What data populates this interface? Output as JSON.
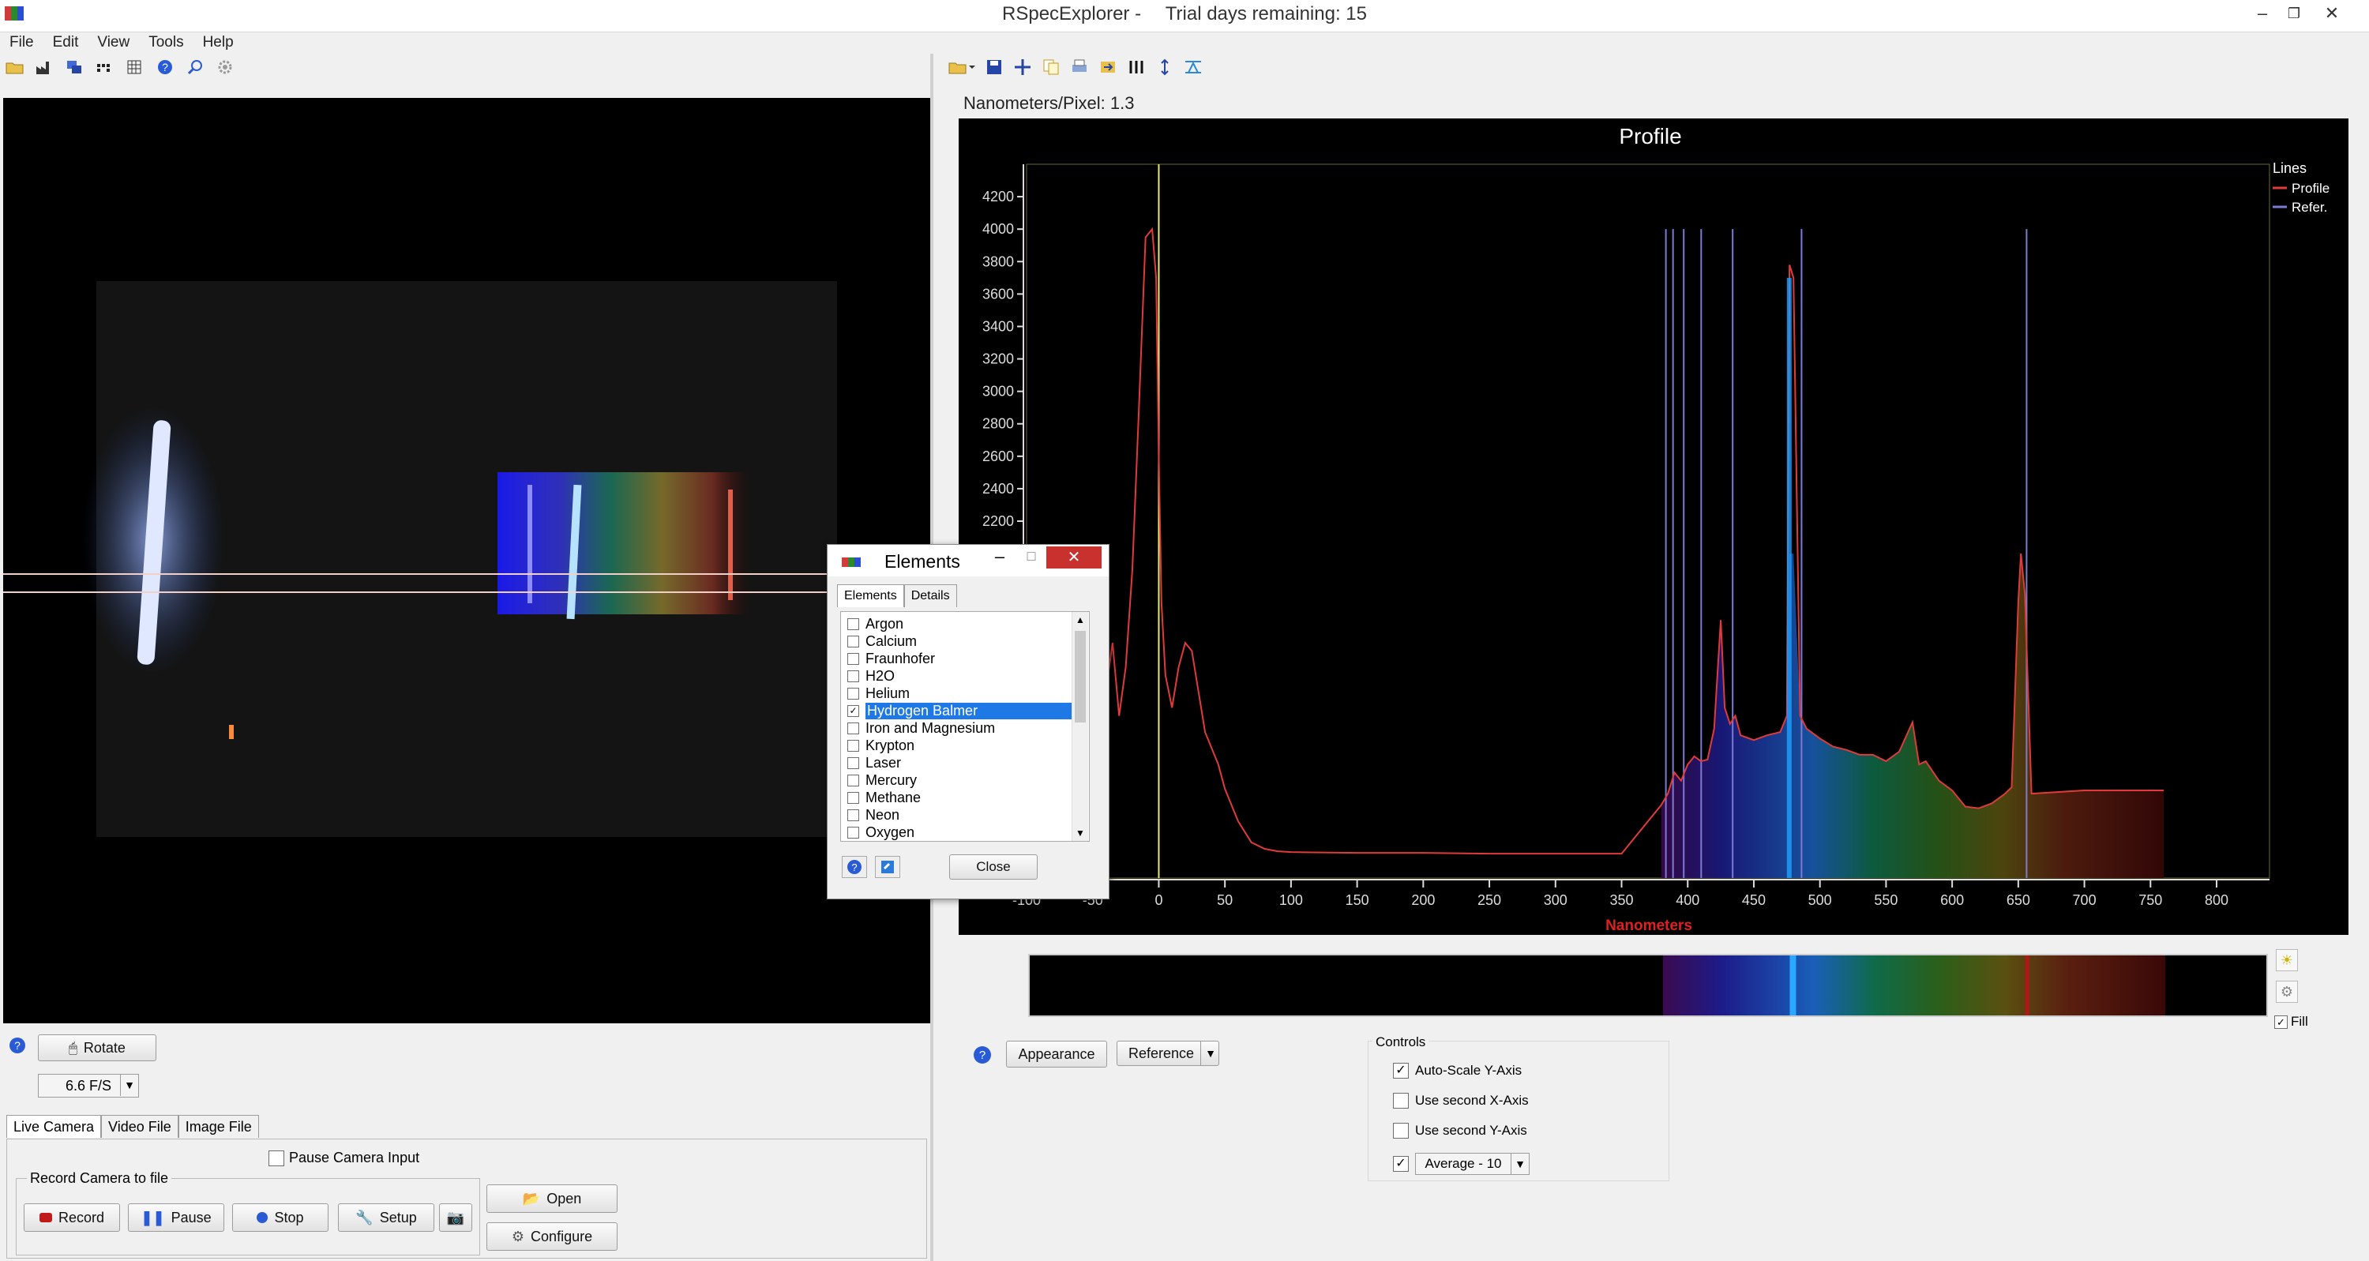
{
  "window": {
    "app_title": "RSpecExplorer -",
    "trial_text": "Trial days remaining: 15"
  },
  "menu": [
    "File",
    "Edit",
    "View",
    "Tools",
    "Help"
  ],
  "camera": {
    "rotate_label": "Rotate",
    "fps_value": "6.6 F/S",
    "tabs": [
      "Live Camera",
      "Video File",
      "Image File"
    ],
    "pause_input_label": "Pause Camera Input",
    "record_group_label": "Record Camera to file",
    "record_label": "Record",
    "pause_label": "Pause",
    "stop_label": "Stop",
    "setup_label": "Setup",
    "open_label": "Open",
    "configure_label": "Configure"
  },
  "profile": {
    "nm_per_pixel": "Nanometers/Pixel: 1.3",
    "appearance_label": "Appearance",
    "reference_label": "Reference",
    "controls_label": "Controls",
    "controls": [
      {
        "label": "Auto-Scale Y-Axis",
        "checked": true
      },
      {
        "label": "Use second X-Axis",
        "checked": false
      },
      {
        "label": "Use second Y-Axis",
        "checked": false
      }
    ],
    "average_value": "Average - 10",
    "fill_label": "Fill"
  },
  "elements_dialog": {
    "title": "Elements",
    "tabs": [
      "Elements",
      "Details"
    ],
    "items": [
      {
        "label": "Argon",
        "checked": false
      },
      {
        "label": "Calcium",
        "checked": false
      },
      {
        "label": "Fraunhofer",
        "checked": false
      },
      {
        "label": "H2O",
        "checked": false
      },
      {
        "label": "Helium",
        "checked": false
      },
      {
        "label": "Hydrogen Balmer",
        "checked": true,
        "selected": true
      },
      {
        "label": "Iron and Magnesium",
        "checked": false
      },
      {
        "label": "Krypton",
        "checked": false
      },
      {
        "label": "Laser",
        "checked": false
      },
      {
        "label": "Mercury",
        "checked": false
      },
      {
        "label": "Methane",
        "checked": false
      },
      {
        "label": "Neon",
        "checked": false
      },
      {
        "label": "Oxygen",
        "checked": false
      }
    ],
    "close_label": "Close"
  },
  "chart_data": {
    "type": "line",
    "title": "Profile",
    "xlabel": "Nanometers",
    "ylabel": "",
    "xlim": [
      -100,
      840
    ],
    "ylim": [
      0,
      4400
    ],
    "x_ticks": [
      -100,
      -50,
      0,
      50,
      100,
      150,
      200,
      250,
      300,
      350,
      400,
      450,
      500,
      550,
      600,
      650,
      700,
      750,
      800
    ],
    "y_ticks": [
      2200,
      2400,
      2600,
      2800,
      3000,
      3200,
      3400,
      3600,
      3800,
      4000,
      4200
    ],
    "legend_title": "Lines",
    "legend_position": "top-right",
    "series": [
      {
        "name": "Profile",
        "color": "#e03a3a",
        "x": [
          -60,
          -55,
          -50,
          -45,
          -40,
          -35,
          -30,
          -25,
          -20,
          -15,
          -10,
          -5,
          -2,
          0,
          2,
          5,
          10,
          15,
          20,
          25,
          30,
          35,
          40,
          45,
          50,
          60,
          70,
          80,
          90,
          100,
          150,
          200,
          250,
          300,
          350,
          380,
          385,
          390,
          395,
          400,
          405,
          410,
          415,
          420,
          425,
          428,
          432,
          436,
          440,
          450,
          460,
          470,
          475,
          477,
          480,
          485,
          490,
          500,
          510,
          520,
          530,
          540,
          550,
          560,
          570,
          575,
          580,
          590,
          600,
          610,
          620,
          630,
          640,
          645,
          650,
          652,
          655,
          660,
          700,
          760
        ],
        "y": [
          0,
          700,
          860,
          1000,
          1150,
          1450,
          1000,
          1300,
          1900,
          2900,
          3950,
          4000,
          3700,
          2600,
          1700,
          1250,
          1050,
          1300,
          1450,
          1400,
          1150,
          900,
          800,
          700,
          550,
          350,
          220,
          180,
          165,
          160,
          155,
          155,
          150,
          150,
          150,
          450,
          520,
          650,
          600,
          700,
          750,
          720,
          730,
          920,
          1590,
          1050,
          950,
          1000,
          880,
          850,
          880,
          900,
          1000,
          3780,
          3700,
          1000,
          920,
          860,
          810,
          790,
          760,
          760,
          720,
          780,
          960,
          700,
          720,
          600,
          540,
          440,
          430,
          460,
          520,
          560,
          1700,
          2000,
          1750,
          520,
          540,
          540
        ]
      },
      {
        "name": "Refer.",
        "color": "#7b7bd6",
        "x": [],
        "y": []
      }
    ],
    "reference_lines_nm": [
      383.5,
      388.9,
      397,
      410.2,
      434,
      486.1,
      656.3
    ],
    "marker_line_nm": 0,
    "grid": false
  }
}
